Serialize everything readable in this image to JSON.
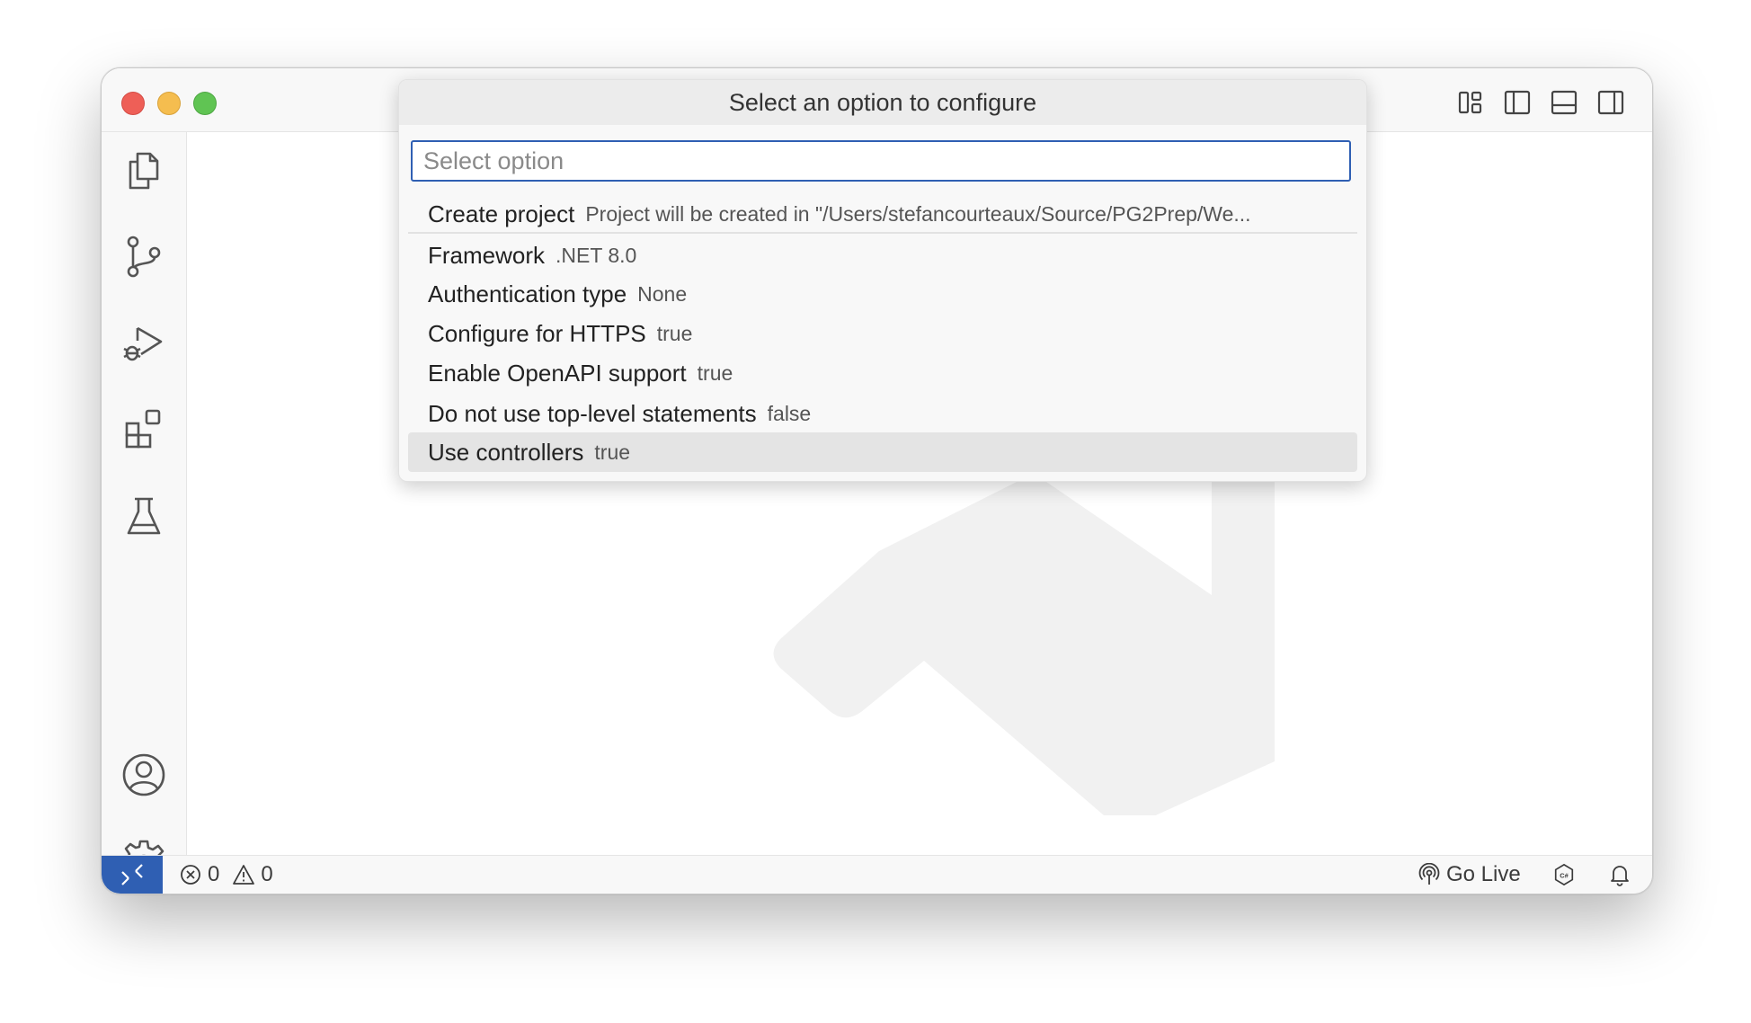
{
  "quickpick": {
    "title": "Select an option to configure",
    "input": {
      "placeholder": "Select option",
      "value": ""
    },
    "items": [
      {
        "label": "Create project",
        "description": "Project will be created in \"/Users/stefancourteaux/Source/PG2Prep/We..."
      },
      {
        "label": "Framework",
        "description": ".NET 8.0"
      },
      {
        "label": "Authentication type",
        "description": "None"
      },
      {
        "label": "Configure for HTTPS",
        "description": "true"
      },
      {
        "label": "Enable OpenAPI support",
        "description": "true"
      },
      {
        "label": "Do not use top-level statements",
        "description": "false"
      },
      {
        "label": "Use controllers",
        "description": "true",
        "selected": true
      }
    ]
  },
  "statusbar": {
    "errors": "0",
    "warnings": "0",
    "go_live": "Go Live"
  },
  "colors": {
    "accent": "#2f5fb3",
    "traffic_red": "#ee5f57",
    "traffic_yellow": "#f5bd4f",
    "traffic_green": "#60c453"
  },
  "icons": {
    "activity_bar": [
      "files-icon",
      "source-control-icon",
      "run-debug-icon",
      "extensions-icon",
      "testing-flask-icon",
      "account-icon",
      "settings-gear-icon"
    ],
    "title_bar": [
      "customize-layout-icon",
      "toggle-primary-sidebar-icon",
      "toggle-panel-icon",
      "toggle-secondary-sidebar-icon"
    ],
    "status_bar": [
      "remote-icon",
      "error-icon",
      "warning-icon",
      "broadcast-icon",
      "csharp-icon",
      "bell-icon"
    ]
  }
}
